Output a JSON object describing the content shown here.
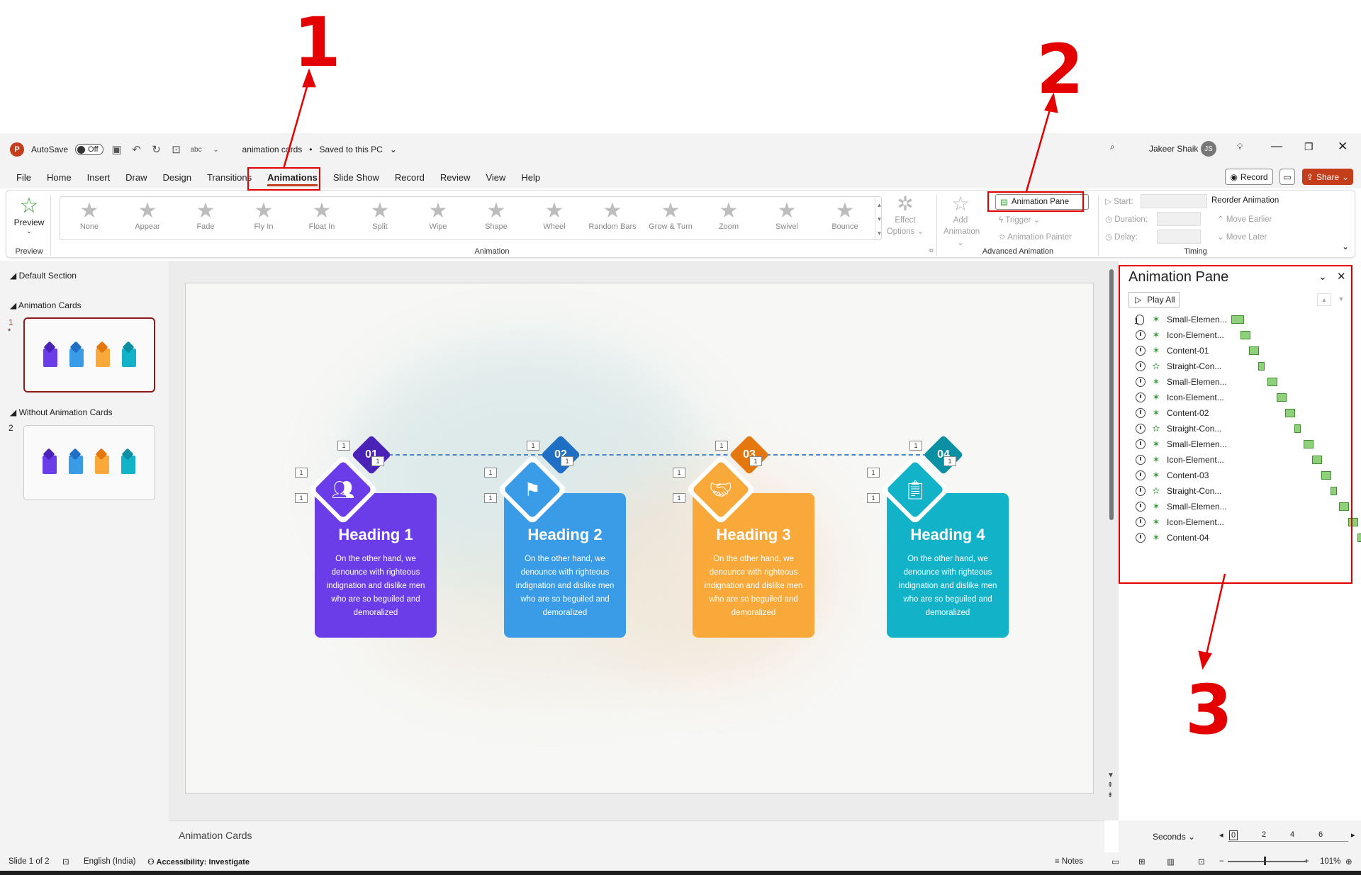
{
  "titlebar": {
    "autosave_label": "AutoSave",
    "autosave_state": "Off",
    "document_title": "animation cards",
    "save_status": "Saved to this PC",
    "user_name": "Jakeer Shaik",
    "user_initials": "JS"
  },
  "tabs": [
    "File",
    "Home",
    "Insert",
    "Draw",
    "Design",
    "Transitions",
    "Animations",
    "Slide Show",
    "Record",
    "Review",
    "View",
    "Help"
  ],
  "active_tab": "Animations",
  "right_buttons": {
    "record": "Record",
    "share": "Share"
  },
  "ribbon": {
    "preview": {
      "label": "Preview",
      "group": "Preview"
    },
    "animation_group": "Animation",
    "effects": [
      "None",
      "Appear",
      "Fade",
      "Fly In",
      "Float In",
      "Split",
      "Wipe",
      "Shape",
      "Wheel",
      "Random Bars",
      "Grow & Turn",
      "Zoom",
      "Swivel",
      "Bounce"
    ],
    "effect_options": [
      "Effect",
      "Options"
    ],
    "advanced": {
      "group": "Advanced Animation",
      "add_animation": [
        "Add",
        "Animation"
      ],
      "animation_pane": "Animation Pane",
      "trigger": "Trigger",
      "animation_painter": "Animation Painter"
    },
    "timing": {
      "group": "Timing",
      "start": "Start:",
      "duration": "Duration:",
      "delay": "Delay:",
      "reorder": "Reorder Animation",
      "move_earlier": "Move Earlier",
      "move_later": "Move Later"
    }
  },
  "slides_panel": {
    "sections": [
      "Default Section",
      "Animation Cards",
      "Without Animation Cards"
    ],
    "slide_numbers": [
      "1",
      "2"
    ]
  },
  "slide": {
    "cards": [
      {
        "number": "01",
        "heading": "Heading 1",
        "body": "On the other hand, we denounce with righteous indignation and dislike men who are so beguiled and demoralized",
        "color": "#6a3de8",
        "dark": "#4a22b8"
      },
      {
        "number": "02",
        "heading": "Heading 2",
        "body": "On the other hand, we denounce with righteous indignation and dislike men who are so beguiled and demoralized",
        "color": "#3a9be6",
        "dark": "#1f6fc4"
      },
      {
        "number": "03",
        "heading": "Heading 3",
        "body": "On the other hand, we denounce with righteous indignation and dislike men who are so beguiled and demoralized",
        "color": "#f8a93a",
        "dark": "#e5770f"
      },
      {
        "number": "04",
        "heading": "Heading 4",
        "body": "On the other hand, we denounce with righteous indignation and dislike men who are so beguiled and demoralized",
        "color": "#12b3c8",
        "dark": "#0b8fa3"
      }
    ],
    "tag_label": "1"
  },
  "notes": "Animation Cards",
  "animation_pane": {
    "title": "Animation Pane",
    "play_all": "Play All",
    "first_index": "1",
    "items": [
      {
        "name": "Small-Elemen...",
        "kind": "click"
      },
      {
        "name": "Icon-Element...",
        "kind": "after"
      },
      {
        "name": "Content-01",
        "kind": "after"
      },
      {
        "name": "Straight-Con...",
        "kind": "after",
        "emphasis": true
      },
      {
        "name": "Small-Elemen...",
        "kind": "after"
      },
      {
        "name": "Icon-Element...",
        "kind": "after"
      },
      {
        "name": "Content-02",
        "kind": "after"
      },
      {
        "name": "Straight-Con...",
        "kind": "after",
        "emphasis": true
      },
      {
        "name": "Small-Elemen...",
        "kind": "after"
      },
      {
        "name": "Icon-Element...",
        "kind": "after"
      },
      {
        "name": "Content-03",
        "kind": "after"
      },
      {
        "name": "Straight-Con...",
        "kind": "after",
        "emphasis": true
      },
      {
        "name": "Small-Elemen...",
        "kind": "after"
      },
      {
        "name": "Icon-Element...",
        "kind": "after"
      },
      {
        "name": "Content-04",
        "kind": "after"
      }
    ],
    "seconds_label": "Seconds",
    "timeline_ticks": [
      "0",
      "2",
      "4",
      "6"
    ]
  },
  "status": {
    "slide": "Slide 1 of 2",
    "language": "English (India)",
    "accessibility": "Accessibility: Investigate",
    "notes": "Notes",
    "zoom": "101%"
  },
  "annotations": [
    "1",
    "2",
    "3"
  ],
  "colors": {
    "accent": "#c43e1c",
    "annotation": "#e40000"
  }
}
